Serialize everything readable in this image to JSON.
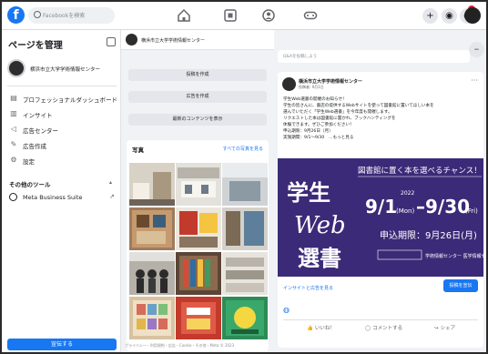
{
  "topbar": {
    "logo": "f",
    "search_placeholder": "Facebookを検索",
    "nav_icons": [
      "home-icon",
      "pages-icon",
      "groups-icon",
      "gaming-icon"
    ],
    "right_icons": [
      "plus-icon",
      "messenger-icon",
      "bell-icon"
    ]
  },
  "sidebar": {
    "title": "ページを管理",
    "page_name": "横浜市立大学学術情報センター",
    "menu": [
      {
        "icon": "dashboard-icon",
        "label": "プロフェッショナルダッシュボード"
      },
      {
        "icon": "insights-icon",
        "label": "インサイト"
      },
      {
        "icon": "ads-center-icon",
        "label": "広告センター"
      },
      {
        "icon": "create-ad-icon",
        "label": "広告作成"
      },
      {
        "icon": "settings-icon",
        "label": "設定"
      }
    ],
    "tools_title": "その他のツール",
    "tools_item": "Meta Business Suite",
    "promo_button": "宣伝する"
  },
  "middle": {
    "header_name": "横浜市立大学学術情報センター",
    "actions": [
      "投稿を作成",
      "広告を作成",
      "最新のコンテンツを表示"
    ],
    "photos_title": "写真",
    "photos_link": "すべての写真を見る",
    "footer": "プライバシー・利用規約・広告・Cookie・その他・Meta © 2023"
  },
  "feed": {
    "composer_placeholder": "Q&Aを投稿しよう",
    "post": {
      "author": "横浜市立大学学術情報センター",
      "meta": "投稿者: 9月1日",
      "body_lines": [
        "学生Web選書の開催のお知らせ！",
        "学生の皆さんに、書店の提供するWebサイトを使って図書館に置いてほしい本を",
        "選んでいただく「学生Web選書」を今年度も開催します。",
        "リクエストした本は図書館に置かれ、ブックハンティングを",
        "体験できます。ぜひご参加ください！",
        "申込期限：9月26日（月）",
        "実施期間：9/1〜9/30　…もっと見る"
      ],
      "banner": {
        "title": "学生Web選書",
        "subtitle": "図書館に置く本を選べるチャンス！",
        "year": "2022",
        "date_from": "9/1",
        "dow_from": "(Mon)",
        "date_to": "9/30",
        "dow_to": "(Fri)",
        "deadline_label": "申込期限：",
        "deadline": "9月26日(月)",
        "footer": "学術情報センター 医学情報センター"
      },
      "insights_link": "インサイトと広告を見る",
      "boost_button": "投稿を宣伝",
      "actions": [
        "いいね！",
        "コメントする",
        "シェア"
      ]
    }
  },
  "colors": {
    "accent": "#1877f2",
    "banner_bg": "#3b2a78",
    "banner_text": "#ffffff",
    "date_text": "#ffffff"
  }
}
